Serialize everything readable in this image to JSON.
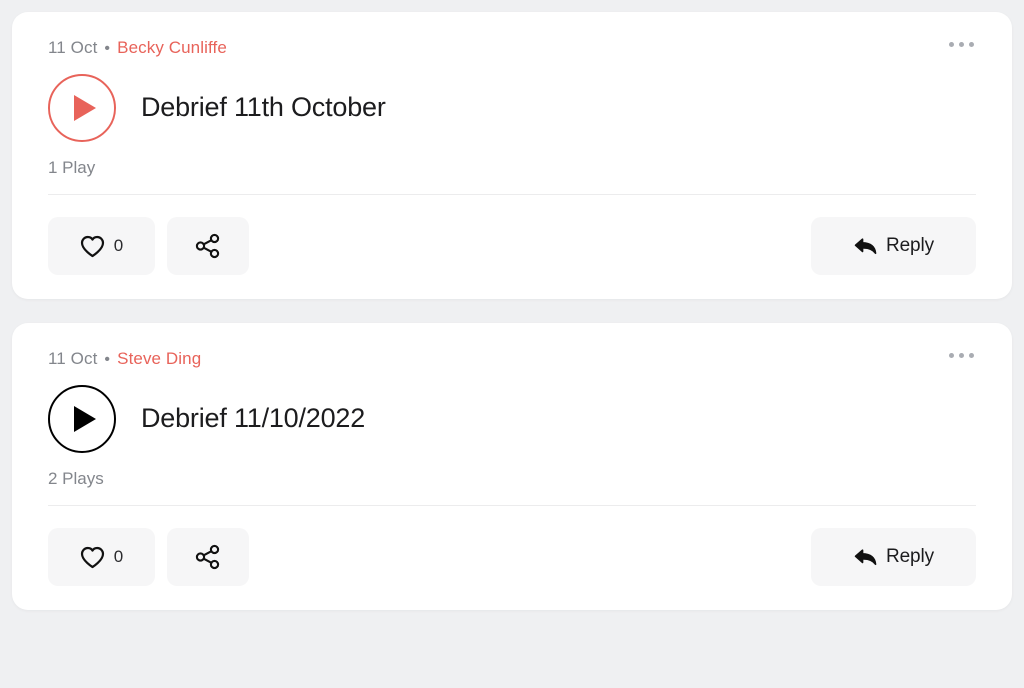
{
  "feed": {
    "posts": [
      {
        "date": "11 Oct",
        "separator": "•",
        "author": "Becky Cunliffe",
        "title": "Debrief 11th October",
        "plays": "1 Play",
        "like_count": "0",
        "reply_label": "Reply",
        "play_state": "accent",
        "menu_icon": "kebab-menu-icon",
        "play_icon": "play-icon",
        "like_icon": "heart-icon",
        "share_icon": "share-icon",
        "reply_icon": "reply-arrow-icon"
      },
      {
        "date": "11 Oct",
        "separator": "•",
        "author": "Steve Ding",
        "title": "Debrief 11/10/2022",
        "plays": "2 Plays",
        "like_count": "0",
        "reply_label": "Reply",
        "play_state": "default",
        "menu_icon": "kebab-menu-icon",
        "play_icon": "play-icon",
        "like_icon": "heart-icon",
        "share_icon": "share-icon",
        "reply_icon": "reply-arrow-icon"
      }
    ]
  },
  "colors": {
    "accent": "#e8635a",
    "page_background": "#eff0f2",
    "card_background": "#ffffff",
    "muted_text": "#83868c",
    "primary_text": "#1c1c1e",
    "pill_background": "#f6f6f7"
  }
}
